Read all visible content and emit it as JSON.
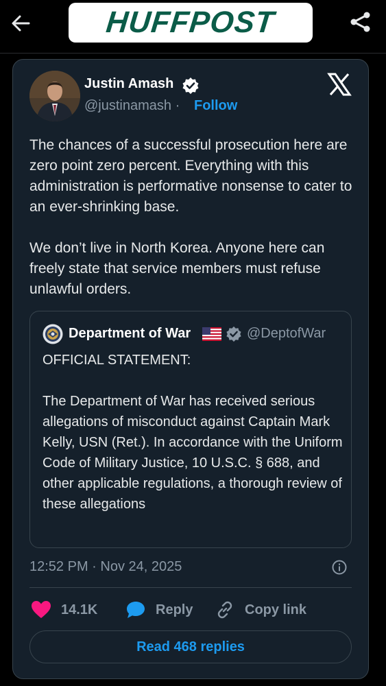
{
  "header": {
    "logo_text": "HUFFPOST",
    "back_icon": "arrow-left-icon",
    "share_icon": "share-icon",
    "logo_color": "#0b5c48"
  },
  "tweet": {
    "author_name": "Justin Amash",
    "handle": "@justinamash",
    "follow_separator": "·",
    "follow_label": "Follow",
    "paragraphs": [
      "The chances of a successful prosecution here are zero point zero percent. Everything with this administration is performative nonsense to cater to an ever-shrinking base.",
      "We don’t live in North Korea. Anyone here can freely state that service members must refuse unlawful orders."
    ],
    "timestamp": "12:52 PM · Nov 24, 2025",
    "accent_color": "#1d9bf0"
  },
  "quoted": {
    "name": "Department of War",
    "flag": "🇺🇸",
    "handle": "@DeptofWar",
    "paragraphs": [
      "OFFICIAL STATEMENT:",
      "The Department of War has received serious allegations of misconduct against Captain Mark Kelly, USN (Ret.). In accordance with the Uniform Code of Military Justice, 10 U.S.C. § 688, and other applicable regulations, a thorough review of these allegations"
    ]
  },
  "actions": {
    "like_count": "14.1K",
    "reply_label": "Reply",
    "copy_label": "Copy link",
    "replies_button": "Read 468 replies",
    "like_color": "#f91880"
  }
}
